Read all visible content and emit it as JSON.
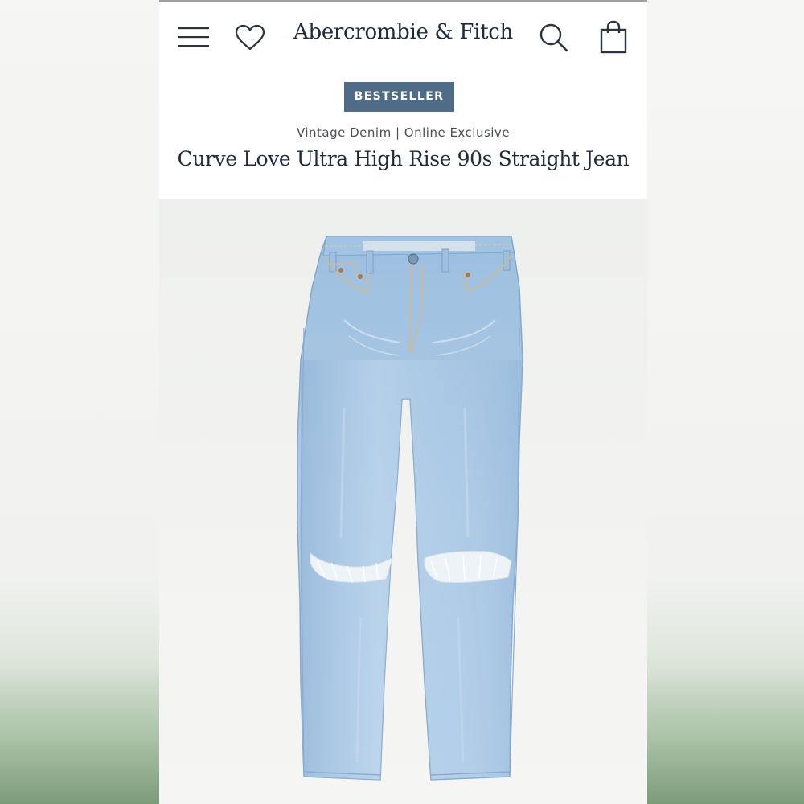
{
  "header": {
    "brand": "Abercrombie & Fitch",
    "icons": [
      "menu-icon",
      "heart-icon",
      "search-icon",
      "shopping-bag-icon"
    ]
  },
  "product": {
    "badge": "BESTSELLER",
    "subline": "Vintage Denim | Online Exclusive",
    "title": "Curve Love Ultra High Rise 90s Straight Jean"
  },
  "colors": {
    "brand_text": "#1d2b3a",
    "badge_bg": "#4e6c88",
    "denim": "#a9c6e3"
  }
}
